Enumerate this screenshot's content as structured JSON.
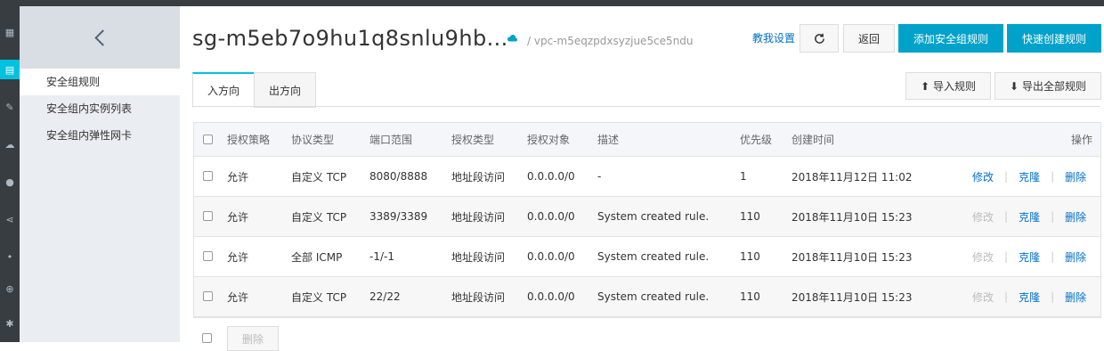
{
  "subnav": {
    "items": [
      {
        "label": "安全组规则"
      },
      {
        "label": "安全组内实例列表"
      },
      {
        "label": "安全组内弹性网卡"
      }
    ]
  },
  "header": {
    "title": "sg-m5eb7o9hu1q8snlu9hb...",
    "vpc": "/ vpc-m5eqzpdxsyzjue5ce5ndu",
    "help_link": "教我设置",
    "refresh_icon": "refresh-icon",
    "back_label": "返回",
    "add_rule_label": "添加安全组规则",
    "quick_create_label": "快速创建规则"
  },
  "tabs": {
    "inbound": "入方向",
    "outbound": "出方向"
  },
  "toolbar": {
    "import_label": "导入规则",
    "export_label": "导出全部规则"
  },
  "table": {
    "headers": {
      "policy": "授权策略",
      "protocol": "协议类型",
      "port": "端口范围",
      "auth_type": "授权类型",
      "auth_target": "授权对象",
      "desc": "描述",
      "priority": "优先级",
      "created": "创建时间",
      "ops": "操作"
    },
    "rows": [
      {
        "policy": "允许",
        "protocol": "自定义 TCP",
        "port": "8080/8888",
        "auth_type": "地址段访问",
        "auth_target": "0.0.0.0/0",
        "desc": "-",
        "priority": "1",
        "created": "2018年11月12日 11:02",
        "edit": "修改",
        "clone": "克隆",
        "delete": "删除"
      },
      {
        "policy": "允许",
        "protocol": "自定义 TCP",
        "port": "3389/3389",
        "auth_type": "地址段访问",
        "auth_target": "0.0.0.0/0",
        "desc": "System created rule.",
        "priority": "110",
        "created": "2018年11月10日 15:23",
        "edit": "修改",
        "clone": "克隆",
        "delete": "删除"
      },
      {
        "policy": "允许",
        "protocol": "全部 ICMP",
        "port": "-1/-1",
        "auth_type": "地址段访问",
        "auth_target": "0.0.0.0/0",
        "desc": "System created rule.",
        "priority": "110",
        "created": "2018年11月10日 15:23",
        "edit": "修改",
        "clone": "克隆",
        "delete": "删除"
      },
      {
        "policy": "允许",
        "protocol": "自定义 TCP",
        "port": "22/22",
        "auth_type": "地址段访问",
        "auth_target": "0.0.0.0/0",
        "desc": "System created rule.",
        "priority": "110",
        "created": "2018年11月10日 15:23",
        "edit": "修改",
        "clone": "克隆",
        "delete": "删除"
      }
    ]
  },
  "footer": {
    "delete_label": "删除"
  }
}
